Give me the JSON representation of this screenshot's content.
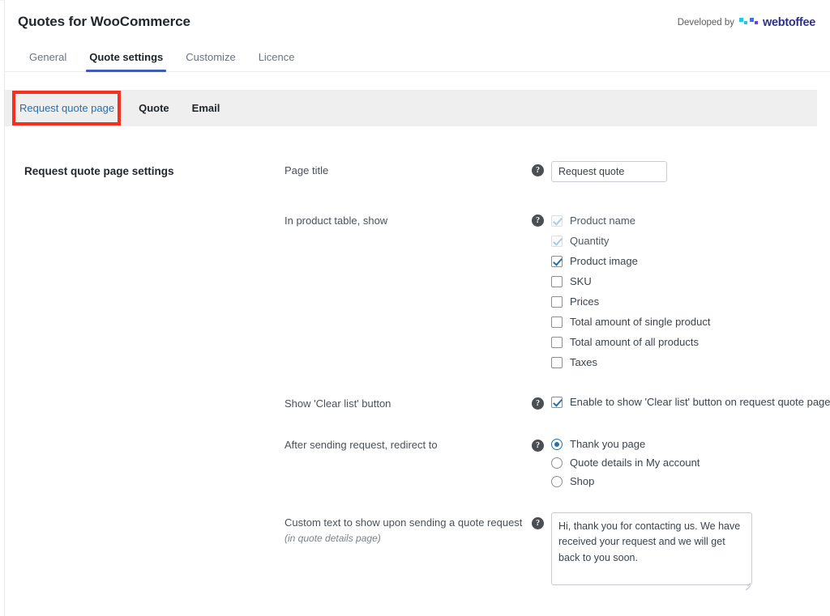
{
  "header": {
    "title": "Quotes for WooCommerce",
    "developed_by_label": "Developed by",
    "brand_name": "webtoffee",
    "brand_colors": {
      "mark_cyan": "#24c6e0",
      "mark_blue": "#3a6ff7",
      "mark_purple": "#6b3df5",
      "wordmark": "#2f2f8f"
    }
  },
  "tabs": [
    {
      "label": "General",
      "active": false
    },
    {
      "label": "Quote settings",
      "active": true
    },
    {
      "label": "Customize",
      "active": false
    },
    {
      "label": "Licence",
      "active": false
    }
  ],
  "subtabs": [
    {
      "label": "Request quote page",
      "active": true,
      "highlighted": true
    },
    {
      "label": "Quote",
      "active": false,
      "highlighted": false
    },
    {
      "label": "Email",
      "active": false,
      "highlighted": false
    }
  ],
  "annotation": {
    "color": "#f5301e",
    "target": "Request quote page"
  },
  "section": {
    "title": "Request quote page settings"
  },
  "help_icon_glyph": "?",
  "rows": {
    "page_title": {
      "label": "Page title",
      "value": "Request quote",
      "placeholder": "Request quote"
    },
    "product_table": {
      "label": "In product table, show",
      "options": [
        {
          "label": "Product name",
          "checked": true,
          "disabled": true
        },
        {
          "label": "Quantity",
          "checked": true,
          "disabled": true
        },
        {
          "label": "Product image",
          "checked": true,
          "disabled": false
        },
        {
          "label": "SKU",
          "checked": false,
          "disabled": false
        },
        {
          "label": "Prices",
          "checked": false,
          "disabled": false
        },
        {
          "label": "Total amount of single product",
          "checked": false,
          "disabled": false
        },
        {
          "label": "Total amount of all products",
          "checked": false,
          "disabled": false
        },
        {
          "label": "Taxes",
          "checked": false,
          "disabled": false
        }
      ]
    },
    "clear_list": {
      "label": "Show 'Clear list' button",
      "option_label": "Enable to show 'Clear list' button on request quote page",
      "checked": true
    },
    "redirect": {
      "label": "After sending request, redirect to",
      "options": [
        {
          "label": "Thank you page",
          "selected": true
        },
        {
          "label": "Quote details in My account",
          "selected": false
        },
        {
          "label": "Shop",
          "selected": false
        }
      ]
    },
    "custom_text": {
      "label": "Custom text to show upon sending a quote request",
      "sublabel": "(in quote details page)",
      "value": "Hi, thank you for contacting us. We have received your request and we will get back to you soon."
    }
  }
}
